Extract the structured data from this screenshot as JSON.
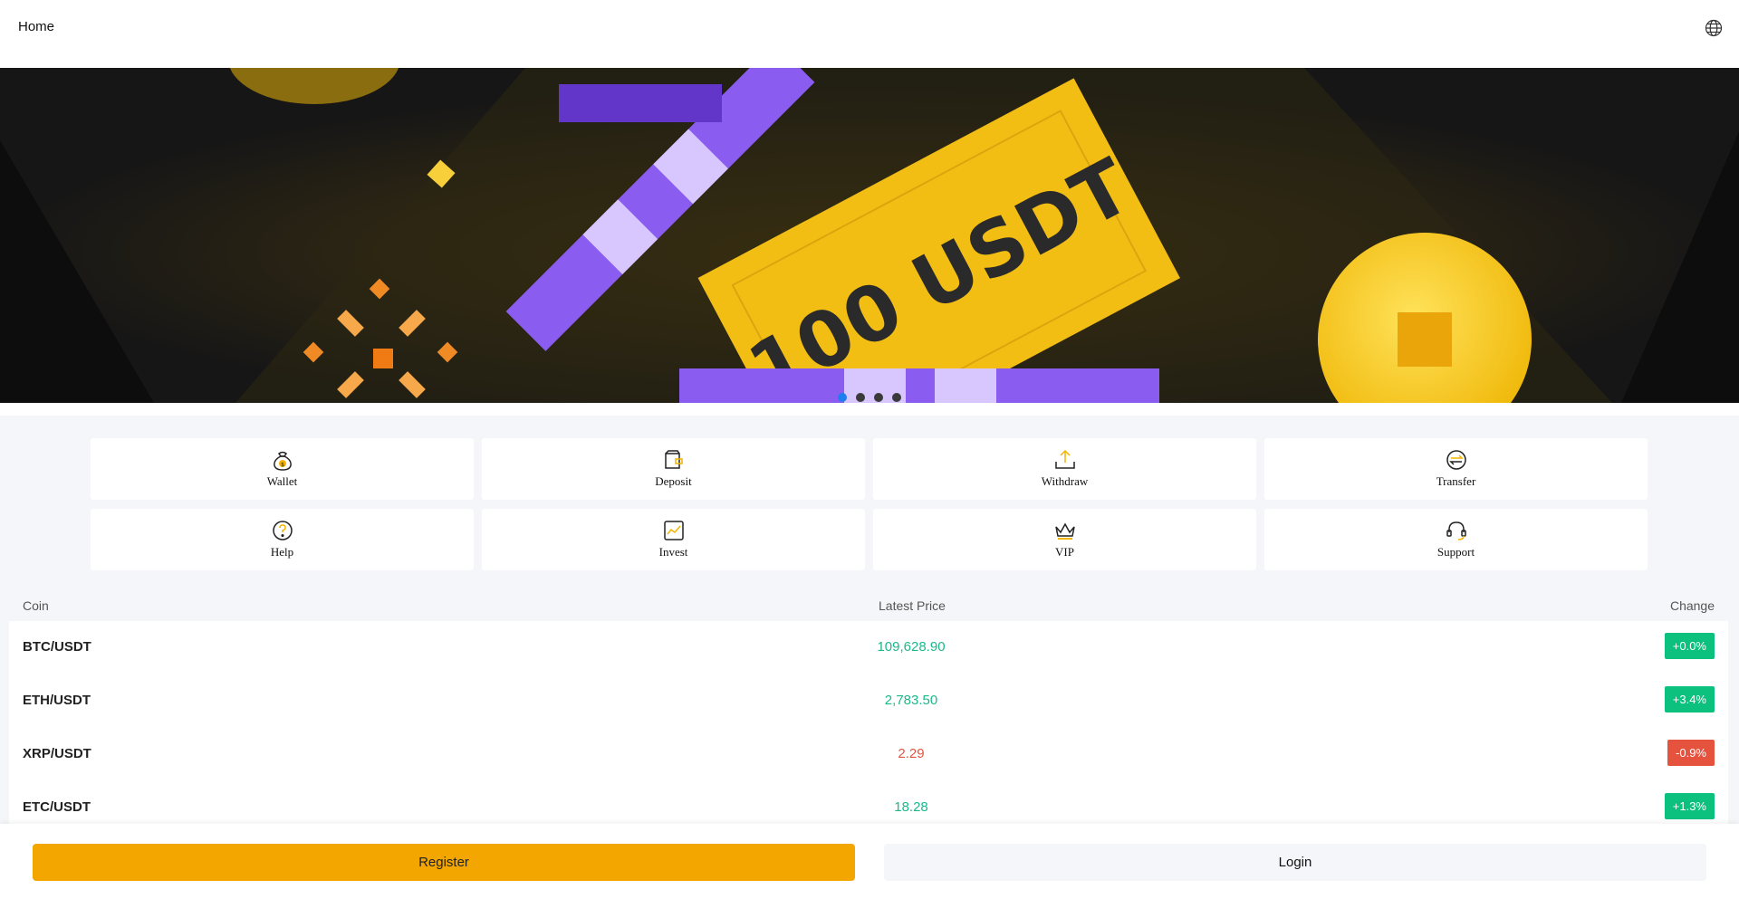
{
  "header": {
    "title": "Home",
    "globe_icon": "globe-icon"
  },
  "banner": {
    "text": "100 USDT",
    "slides": 4,
    "active_slide": 1
  },
  "menu": [
    {
      "label": "Wallet",
      "icon": "wallet-bag-icon"
    },
    {
      "label": "Deposit",
      "icon": "deposit-wallet-icon"
    },
    {
      "label": "Withdraw",
      "icon": "withdraw-upload-icon"
    },
    {
      "label": "Transfer",
      "icon": "transfer-arrows-icon"
    },
    {
      "label": "Help",
      "icon": "help-question-icon"
    },
    {
      "label": "Invest",
      "icon": "invest-chart-icon"
    },
    {
      "label": "VIP",
      "icon": "vip-crown-icon"
    },
    {
      "label": "Support",
      "icon": "support-headset-icon"
    }
  ],
  "market": {
    "headers": {
      "coin": "Coin",
      "price": "Latest Price",
      "change": "Change"
    },
    "rows": [
      {
        "coin": "BTC/USDT",
        "price": "109,628.90",
        "change": "+0.0%",
        "direction": "up"
      },
      {
        "coin": "ETH/USDT",
        "price": "2,783.50",
        "change": "+3.4%",
        "direction": "up"
      },
      {
        "coin": "XRP/USDT",
        "price": "2.29",
        "change": "-0.9%",
        "direction": "down"
      },
      {
        "coin": "ETC/USDT",
        "price": "18.28",
        "change": "+1.3%",
        "direction": "up"
      }
    ]
  },
  "footer": {
    "register_label": "Register",
    "login_label": "Login"
  },
  "colors": {
    "accent": "#f4a600",
    "up": "#0cc07e",
    "down": "#e5533f",
    "dot_active": "#1e7ef0"
  }
}
